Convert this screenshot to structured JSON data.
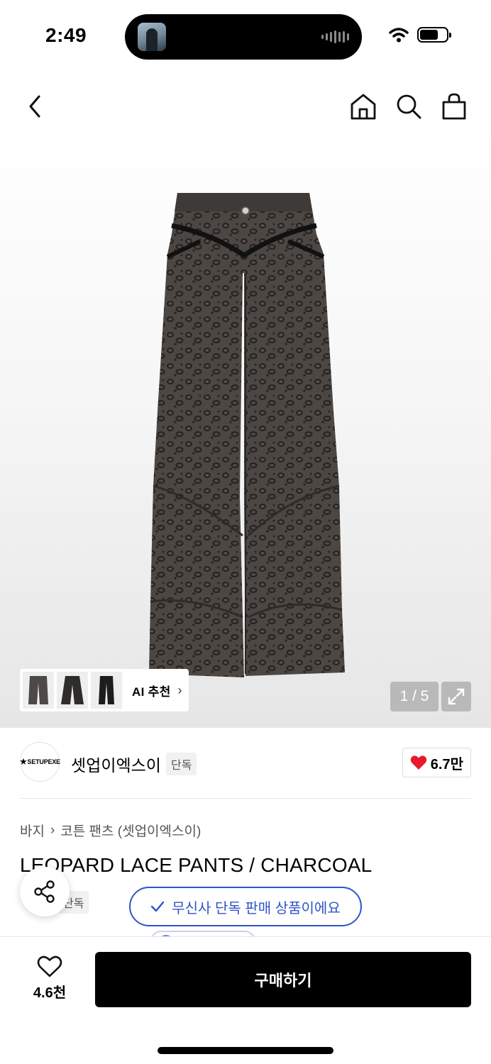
{
  "status_bar": {
    "time": "2:49",
    "battery_level": 0.7
  },
  "nav": {
    "back_icon": "chevron-left-icon",
    "home_icon": "home-icon",
    "search_icon": "search-icon",
    "cart_icon": "shopping-bag-icon"
  },
  "gallery": {
    "ai_recommend_label": "AI 추천",
    "page_counter": "1 / 5",
    "current_page": 1,
    "total_pages": 5
  },
  "brand": {
    "logo_text": "SETUPEXE",
    "name": "셋업이엑스이",
    "badge": "단독",
    "like_count": "6.7만",
    "heart_color": "#e8192c"
  },
  "product": {
    "breadcrumb": [
      "바지",
      "코튼 팬츠 (셋업이엑스이)"
    ],
    "title": "LEOPARD LACE PANTS / CHARCOAL",
    "badge": "단독",
    "exclusive_notice": "무신사 단독 판매 상품이에요",
    "accent_color": "#2f55c8"
  },
  "bottom_bar": {
    "wish_count": "4.6천",
    "buy_label": "구매하기"
  }
}
